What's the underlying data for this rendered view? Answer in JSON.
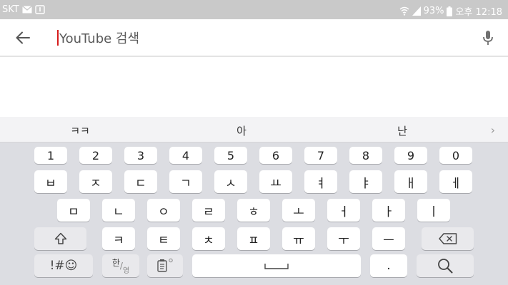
{
  "status_bar": {
    "carrier": "SKT",
    "battery": "93%",
    "time": "오후 12:18"
  },
  "search": {
    "placeholder": "YouTube 검색"
  },
  "keyboard": {
    "suggestions": [
      "ㅋㅋ",
      "아",
      "난"
    ],
    "number_row": [
      "1",
      "2",
      "3",
      "4",
      "5",
      "6",
      "7",
      "8",
      "9",
      "0"
    ],
    "row1": [
      "ㅂ",
      "ㅈ",
      "ㄷ",
      "ㄱ",
      "ㅅ",
      "ㅛ",
      "ㅕ",
      "ㅑ",
      "ㅐ",
      "ㅔ"
    ],
    "row2": [
      "ㅁ",
      "ㄴ",
      "ㅇ",
      "ㄹ",
      "ㅎ",
      "ㅗ",
      "ㅓ",
      "ㅏ",
      "ㅣ"
    ],
    "row3": [
      "ㅋ",
      "ㅌ",
      "ㅊ",
      "ㅍ",
      "ㅠ",
      "ㅜ",
      "ㅡ"
    ],
    "symbols_label": "!#☺",
    "lang_label_main": "한",
    "lang_label_sub": "영",
    "period_label": "."
  }
}
